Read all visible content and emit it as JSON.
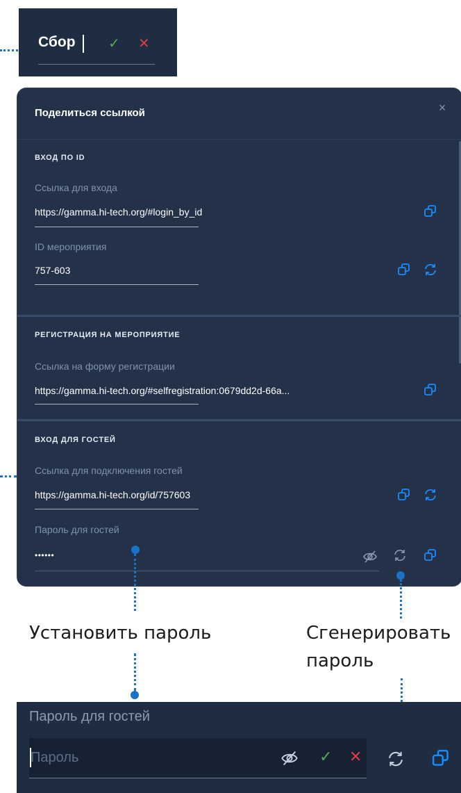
{
  "title_editor": {
    "value": "Сбор",
    "confirm_glyph": "✓",
    "cancel_glyph": "✕"
  },
  "dialog": {
    "title": "Поделиться ссылкой",
    "close_glyph": "×",
    "sections": [
      {
        "title": "ВХОД ПО ID",
        "fields": [
          {
            "label": "Ссылка для входа",
            "value": "https://gamma.hi-tech.org/#login_by_id"
          },
          {
            "label": "ID мероприятия",
            "value": "757-603"
          }
        ]
      },
      {
        "title": "РЕГИСТРАЦИЯ НА МЕРОПРИЯТИЕ",
        "fields": [
          {
            "label": "Ссылка на форму регистрации",
            "value": "https://gamma.hi-tech.org/#selfregistration:0679dd2d-66a..."
          }
        ]
      },
      {
        "title": "ВХОД ДЛЯ ГОСТЕЙ",
        "fields": [
          {
            "label": "Ссылка для подключения гостей",
            "value": "https://gamma.hi-tech.org/id/757603"
          },
          {
            "label": "Пароль для гостей",
            "value": "••••••"
          }
        ]
      }
    ]
  },
  "captions": {
    "set_password": "Установить пароль",
    "generate_password_line1": "Сгенерировать",
    "generate_password_line2": "пароль"
  },
  "password_editor": {
    "label": "Пароль для гостей",
    "placeholder": "Пароль",
    "confirm_glyph": "✓",
    "cancel_glyph": "✕"
  },
  "colors": {
    "accent": "#1a8cff",
    "panel_bg": "#233249",
    "confirm": "#4caf50",
    "cancel": "#d9413d"
  },
  "icons": [
    "copy-icon",
    "refresh-icon",
    "eye-off-icon",
    "close-icon",
    "check-icon"
  ]
}
